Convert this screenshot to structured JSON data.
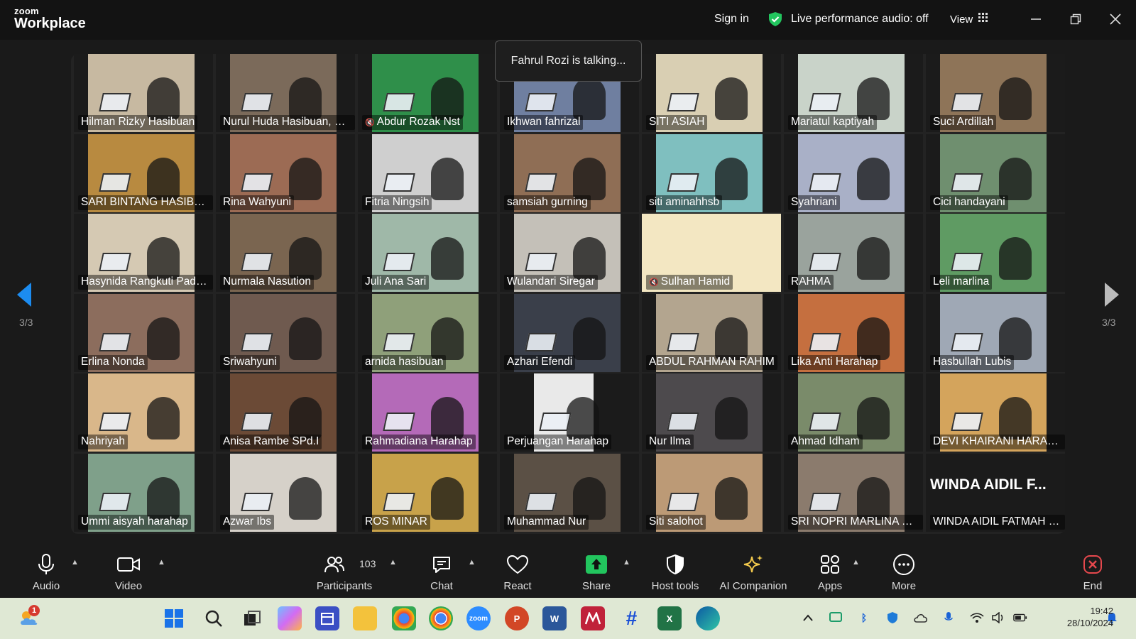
{
  "app": {
    "logo_line1": "zoom",
    "logo_line2": "Workplace"
  },
  "header": {
    "sign_in": "Sign in",
    "live_audio": "Live performance audio: off",
    "view": "View",
    "speaking": "Fahrul Rozi is talking..."
  },
  "pagination": {
    "left": "3/3",
    "right": "3/3"
  },
  "participants": [
    {
      "name": "Hilman Rizky Hasibuan",
      "bg": "#c7b9a1"
    },
    {
      "name": "Nurul Huda Hasibuan, S.Ag",
      "bg": "#7b6a5a"
    },
    {
      "name": "Abdur Rozak Nst",
      "bg": "#2f8f4a",
      "muted": true
    },
    {
      "name": "Ikhwan fahrizal",
      "bg": "#6f7fa0"
    },
    {
      "name": "SITI ASIAH",
      "bg": "#d9cfb3"
    },
    {
      "name": "Mariatul kaptiyah",
      "bg": "#c9d3c9"
    },
    {
      "name": "Suci Ardillah",
      "bg": "#8e7458"
    },
    {
      "name": "SARI BINTANG HASIBUAN...",
      "bg": "#b88a40"
    },
    {
      "name": "Rina Wahyuni",
      "bg": "#9c6b54"
    },
    {
      "name": "Fitria Ningsih",
      "bg": "#cfcfcf"
    },
    {
      "name": "samsiah gurning",
      "bg": "#8f6e55"
    },
    {
      "name": "siti aminahhsb",
      "bg": "#7fbfbf"
    },
    {
      "name": "Syahriani",
      "bg": "#a9b0c7"
    },
    {
      "name": "Cici handayani",
      "bg": "#6f8f6f"
    },
    {
      "name": "Hasynida Rangkuti Padan...",
      "bg": "#d5c9b3"
    },
    {
      "name": "Nurmala Nasution",
      "bg": "#7a6550"
    },
    {
      "name": "Juli Ana Sari",
      "bg": "#9fb8a8"
    },
    {
      "name": "Wulandari Siregar",
      "bg": "#c4c0b8"
    },
    {
      "name": "Sulhan Hamid",
      "bg": "#f3e7c2",
      "muted": true,
      "full": true
    },
    {
      "name": "RAHMA",
      "bg": "#9aa39d"
    },
    {
      "name": "Leli marlina",
      "bg": "#5f9b63"
    },
    {
      "name": "Erlina Nonda",
      "bg": "#8c6d5d"
    },
    {
      "name": "Sriwahyuni",
      "bg": "#6f5a4f"
    },
    {
      "name": "arnida hasibuan",
      "bg": "#8fa07a"
    },
    {
      "name": "Azhari Efendi",
      "bg": "#3a3f4a"
    },
    {
      "name": "ABDUL RAHMAN RAHIM",
      "bg": "#b3a58f"
    },
    {
      "name": "Lika Anti Harahap",
      "bg": "#c56f3f"
    },
    {
      "name": "Hasbullah Lubis",
      "bg": "#9fa8b5"
    },
    {
      "name": "Nahriyah",
      "bg": "#d9b78a"
    },
    {
      "name": "Anisa Rambe SPd.I",
      "bg": "#6b4a36"
    },
    {
      "name": "Rahmadiana Harahap",
      "bg": "#b46ab8"
    },
    {
      "name": "Perjuangan Harahap",
      "bg": "#e9e9e9",
      "narrow": true
    },
    {
      "name": "Nur Ilma",
      "bg": "#4d4a4d"
    },
    {
      "name": "Ahmad Idham",
      "bg": "#7a8b6a"
    },
    {
      "name": "DEVI KHAIRANI HARAHAP",
      "bg": "#d4a45c"
    },
    {
      "name": "Ummi aisyah harahap",
      "bg": "#7fa08a"
    },
    {
      "name": "Azwar Ibs",
      "bg": "#d6d1c9"
    },
    {
      "name": "ROS MINAR",
      "bg": "#c8a24a"
    },
    {
      "name": "Muhammad Nur",
      "bg": "#5b5045"
    },
    {
      "name": "Siti salohot",
      "bg": "#bc9a76"
    },
    {
      "name": "SRI NOPRI MARLINA RAM...",
      "bg": "#8b7b6d"
    },
    {
      "name": "WINDA AIDIL FATMAH HA...",
      "bg": "#1b1b1b",
      "novideo": true,
      "bigname": "WINDA AIDIL F..."
    }
  ],
  "toolbar": {
    "audio": "Audio",
    "video": "Video",
    "participants": "Participants",
    "participant_count": "103",
    "chat": "Chat",
    "react": "React",
    "share": "Share",
    "host_tools": "Host tools",
    "ai_companion": "AI Companion",
    "apps": "Apps",
    "more": "More",
    "end": "End"
  },
  "taskbar": {
    "weather_badge": "1",
    "time": "19:42",
    "date": "28/10/2024"
  },
  "colors": {
    "accent": "#1c8cf0",
    "share_green": "#22c55e",
    "end_red": "#e5484d"
  }
}
